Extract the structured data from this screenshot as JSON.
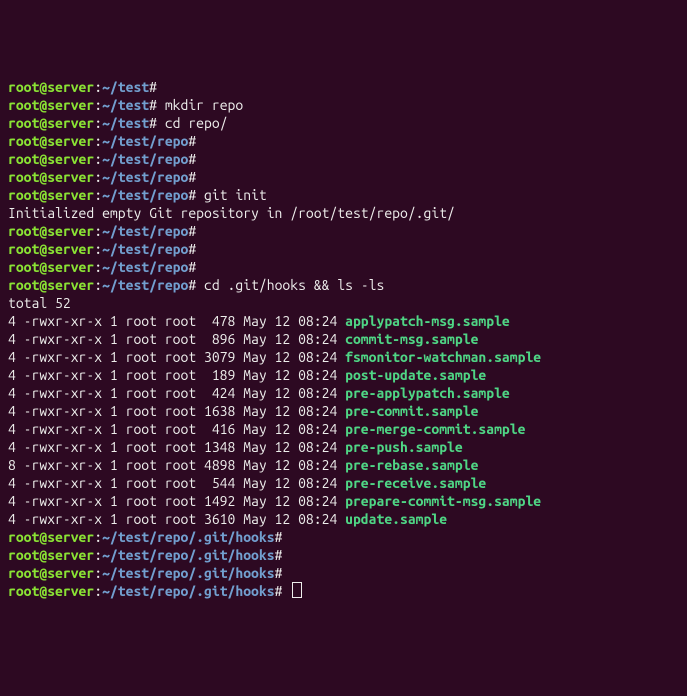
{
  "prompts": {
    "test": {
      "user": "root",
      "host": "server",
      "path": "~/test"
    },
    "repo": {
      "user": "root",
      "host": "server",
      "path": "~/test/repo"
    },
    "hooks": {
      "user": "root",
      "host": "server",
      "path": "~/test/repo/.git/hooks"
    }
  },
  "history": [
    {
      "prompt": "test",
      "cmd": ""
    },
    {
      "prompt": "test",
      "cmd": "mkdir repo"
    },
    {
      "prompt": "test",
      "cmd": "cd repo/"
    },
    {
      "prompt": "repo",
      "cmd": ""
    },
    {
      "prompt": "repo",
      "cmd": ""
    },
    {
      "prompt": "repo",
      "cmd": ""
    },
    {
      "prompt": "repo",
      "cmd": "git init"
    },
    {
      "output": "Initialized empty Git repository in /root/test/repo/.git/"
    },
    {
      "prompt": "repo",
      "cmd": ""
    },
    {
      "prompt": "repo",
      "cmd": ""
    },
    {
      "prompt": "repo",
      "cmd": ""
    },
    {
      "prompt": "repo",
      "cmd": "cd .git/hooks && ls -ls"
    },
    {
      "output": "total 52"
    },
    {
      "ls": {
        "blocks": "4",
        "perm": "-rwxr-xr-x",
        "links": "1",
        "owner": "root",
        "group": "root",
        "size": "478",
        "date": "May 12 08:24",
        "name": "applypatch-msg.sample"
      }
    },
    {
      "ls": {
        "blocks": "4",
        "perm": "-rwxr-xr-x",
        "links": "1",
        "owner": "root",
        "group": "root",
        "size": "896",
        "date": "May 12 08:24",
        "name": "commit-msg.sample"
      }
    },
    {
      "ls": {
        "blocks": "4",
        "perm": "-rwxr-xr-x",
        "links": "1",
        "owner": "root",
        "group": "root",
        "size": "3079",
        "date": "May 12 08:24",
        "name": "fsmonitor-watchman.sample"
      }
    },
    {
      "ls": {
        "blocks": "4",
        "perm": "-rwxr-xr-x",
        "links": "1",
        "owner": "root",
        "group": "root",
        "size": "189",
        "date": "May 12 08:24",
        "name": "post-update.sample"
      }
    },
    {
      "ls": {
        "blocks": "4",
        "perm": "-rwxr-xr-x",
        "links": "1",
        "owner": "root",
        "group": "root",
        "size": "424",
        "date": "May 12 08:24",
        "name": "pre-applypatch.sample"
      }
    },
    {
      "ls": {
        "blocks": "4",
        "perm": "-rwxr-xr-x",
        "links": "1",
        "owner": "root",
        "group": "root",
        "size": "1638",
        "date": "May 12 08:24",
        "name": "pre-commit.sample"
      }
    },
    {
      "ls": {
        "blocks": "4",
        "perm": "-rwxr-xr-x",
        "links": "1",
        "owner": "root",
        "group": "root",
        "size": "416",
        "date": "May 12 08:24",
        "name": "pre-merge-commit.sample"
      }
    },
    {
      "ls": {
        "blocks": "4",
        "perm": "-rwxr-xr-x",
        "links": "1",
        "owner": "root",
        "group": "root",
        "size": "1348",
        "date": "May 12 08:24",
        "name": "pre-push.sample"
      }
    },
    {
      "ls": {
        "blocks": "8",
        "perm": "-rwxr-xr-x",
        "links": "1",
        "owner": "root",
        "group": "root",
        "size": "4898",
        "date": "May 12 08:24",
        "name": "pre-rebase.sample"
      }
    },
    {
      "ls": {
        "blocks": "4",
        "perm": "-rwxr-xr-x",
        "links": "1",
        "owner": "root",
        "group": "root",
        "size": "544",
        "date": "May 12 08:24",
        "name": "pre-receive.sample"
      }
    },
    {
      "ls": {
        "blocks": "4",
        "perm": "-rwxr-xr-x",
        "links": "1",
        "owner": "root",
        "group": "root",
        "size": "1492",
        "date": "May 12 08:24",
        "name": "prepare-commit-msg.sample"
      }
    },
    {
      "ls": {
        "blocks": "4",
        "perm": "-rwxr-xr-x",
        "links": "1",
        "owner": "root",
        "group": "root",
        "size": "3610",
        "date": "May 12 08:24",
        "name": "update.sample"
      }
    },
    {
      "prompt": "hooks",
      "cmd": ""
    },
    {
      "prompt": "hooks",
      "cmd": ""
    },
    {
      "prompt": "hooks",
      "cmd": ""
    },
    {
      "prompt": "hooks",
      "cmd": "",
      "cursor": true
    }
  ]
}
